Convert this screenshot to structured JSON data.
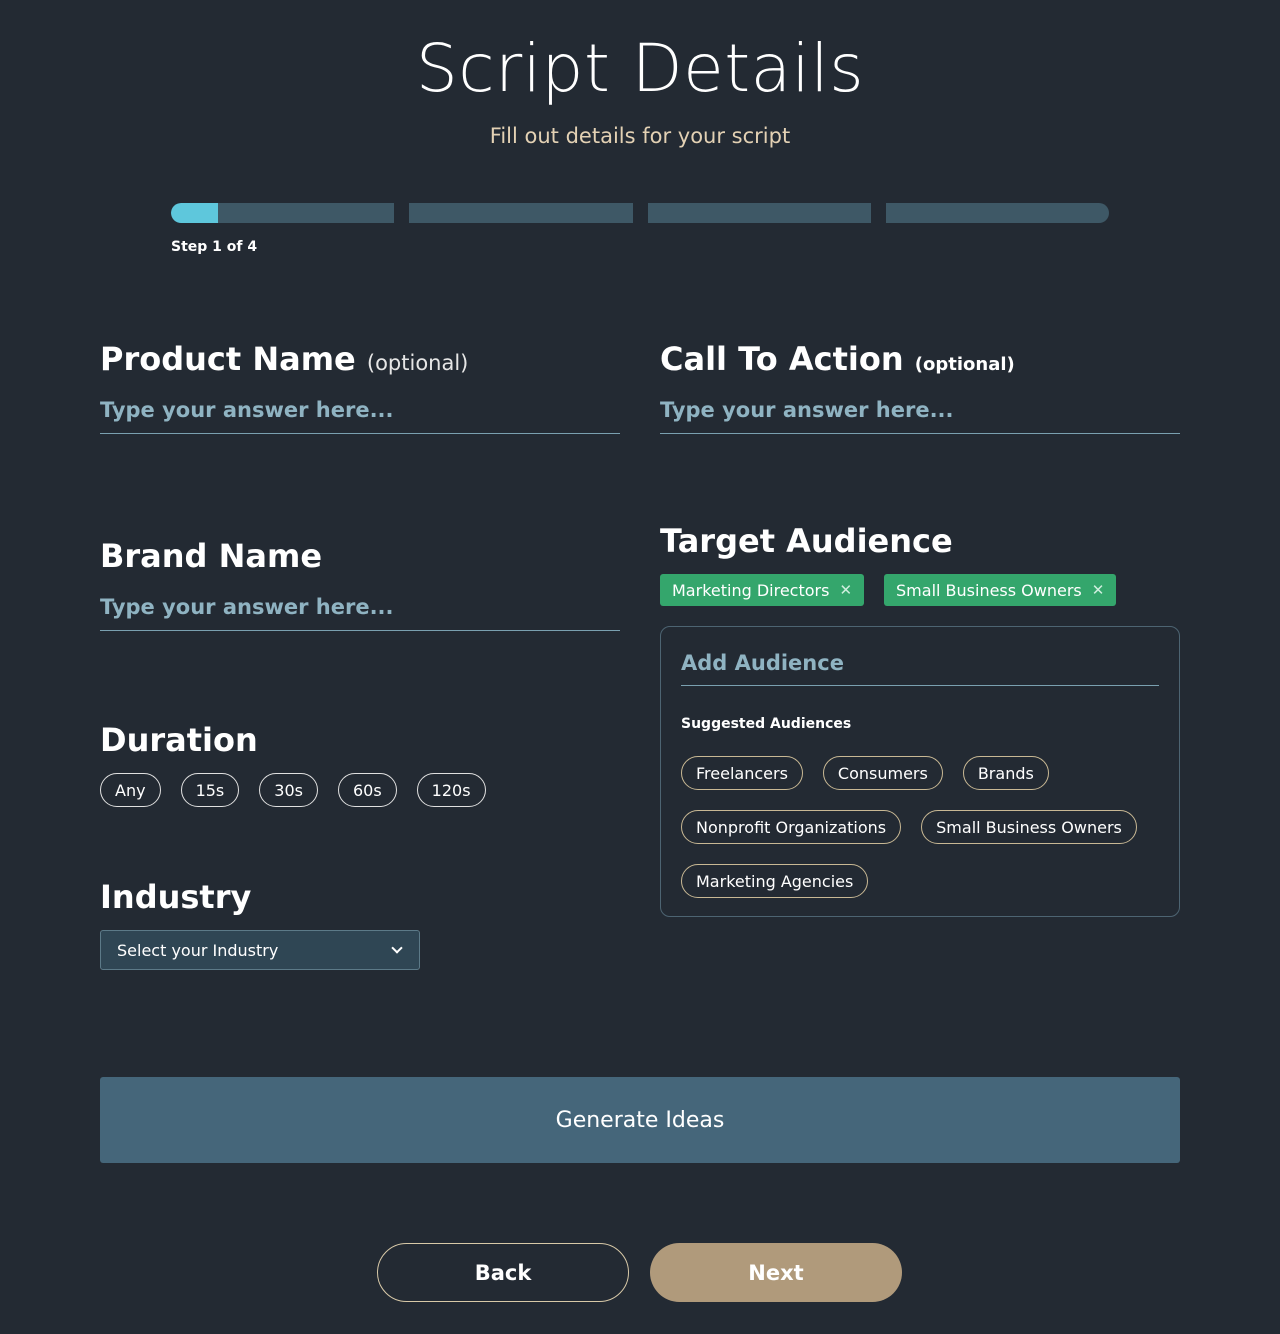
{
  "header": {
    "title": "Script Details",
    "subtitle": "Fill out details for your script"
  },
  "progress": {
    "step_label": "Step 1 of 4",
    "segments": 4,
    "current_step": 1,
    "first_segment_fill": 0.21,
    "accent_color": "#5ec7dc"
  },
  "product_name": {
    "label": "Product Name",
    "optional": "(optional)",
    "placeholder": "Type your answer here..."
  },
  "call_to_action": {
    "label": "Call To Action",
    "optional": "(optional)",
    "placeholder": "Type your answer here..."
  },
  "brand_name": {
    "label": "Brand Name",
    "placeholder": "Type your answer here..."
  },
  "target_audience": {
    "label": "Target Audience",
    "selected": [
      {
        "label": "Marketing Directors",
        "remove_icon": "close-icon"
      },
      {
        "label": "Small Business Owners",
        "remove_icon": "close-icon"
      }
    ],
    "add_placeholder": "Add Audience",
    "suggested_label": "Suggested Audiences",
    "suggested": [
      "Freelancers",
      "Consumers",
      "Brands",
      "Nonprofit Organizations",
      "Small Business Owners",
      "Marketing Agencies"
    ]
  },
  "duration": {
    "label": "Duration",
    "options": [
      "Any",
      "15s",
      "30s",
      "60s",
      "120s"
    ]
  },
  "industry": {
    "label": "Industry",
    "placeholder": "Select your Industry"
  },
  "actions": {
    "generate": "Generate Ideas",
    "back": "Back",
    "next": "Next"
  },
  "colors": {
    "background": "#232a33",
    "tag_green": "#34a66c",
    "next_button": "#b09a7b",
    "generate_button": "#45667a",
    "subtitle": "#e3d1b4"
  }
}
